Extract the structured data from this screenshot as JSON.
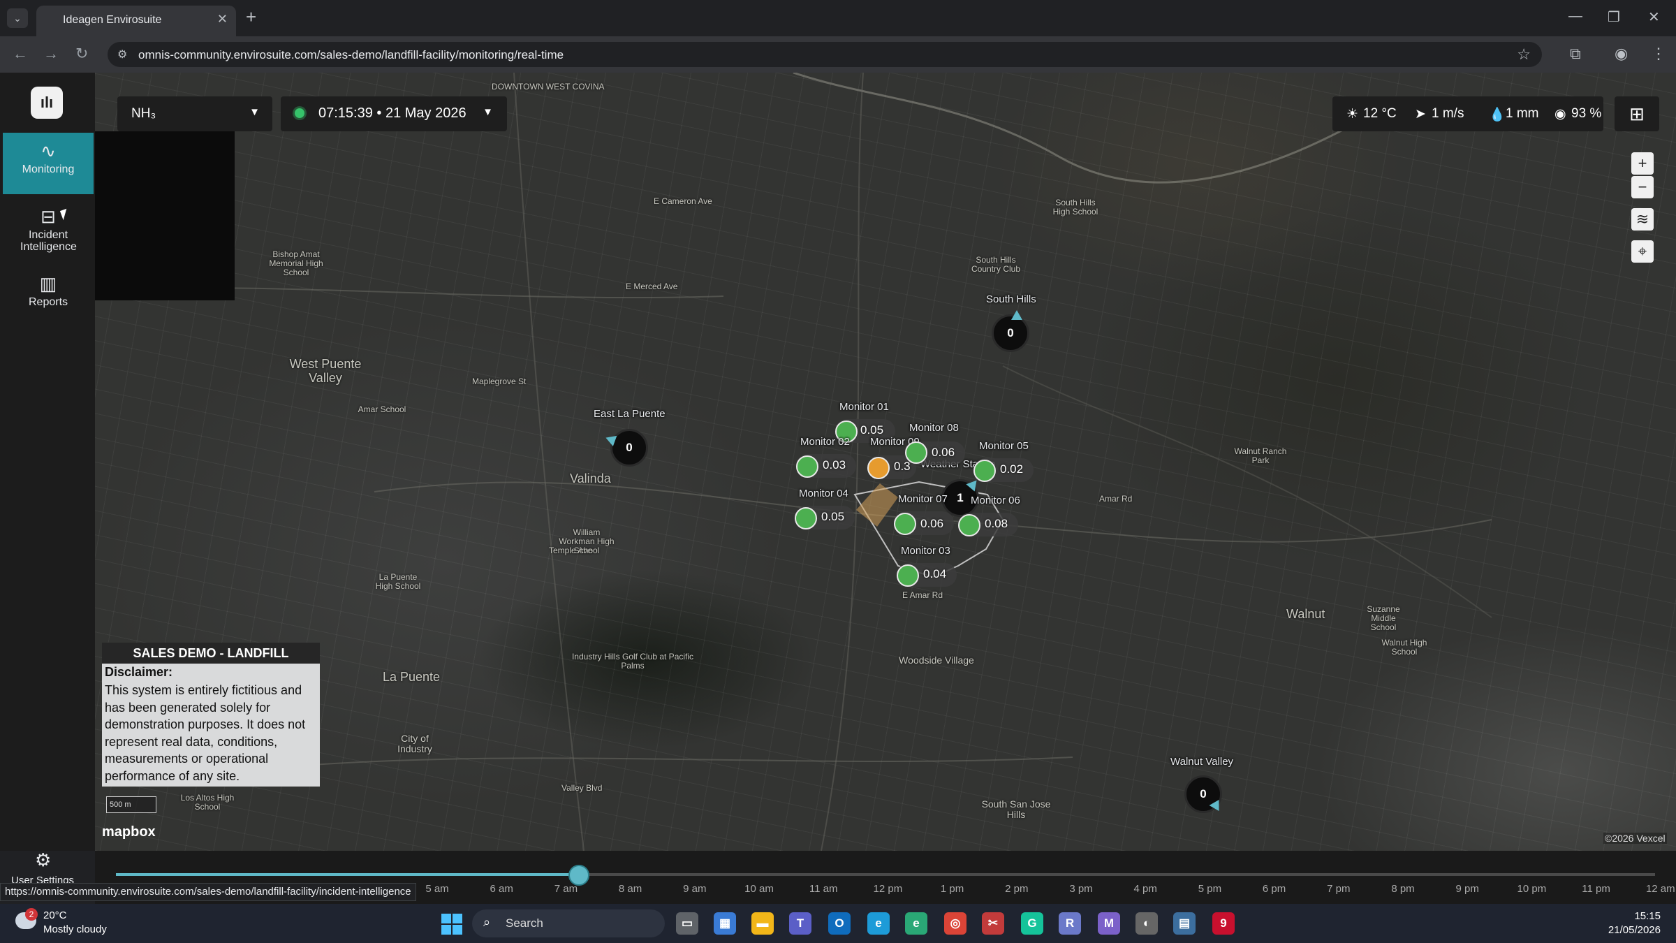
{
  "browser": {
    "tab_title": "Ideagen Envirosuite",
    "url": "omnis-community.envirosuite.com/sales-demo/landfill-facility/monitoring/real-time",
    "status_url": "https://omnis-community.envirosuite.com/sales-demo/landfill-facility/incident-intelligence"
  },
  "sidenav": {
    "items": [
      {
        "label": "Monitoring",
        "icon": "pulse-icon",
        "active": true
      },
      {
        "label": "Incident Intelligence",
        "icon": "incident-icon",
        "active": false
      },
      {
        "label": "Reports",
        "icon": "bar-chart-icon",
        "active": false
      }
    ],
    "settings_label": "User Settings"
  },
  "controls": {
    "pollutant": "NH₃",
    "time": "07:15:39 • 21 May 2026",
    "weather": {
      "temp": "12 °C",
      "wind": "1 m/s",
      "rain": "1 mm",
      "humidity": "93 %"
    }
  },
  "map": {
    "places": [
      "DOWNTOWN WEST COVINA",
      "West Puente Valley",
      "Valinda",
      "La Puente",
      "City of Industry",
      "Woodside Village",
      "Walnut",
      "Walnut Ranch Park",
      "South San Jose Hills",
      "Industry Hills Golf Club at Pacific Palms",
      "Bishop Amat Memorial High School",
      "South Hills Country Club",
      "Suzanne Middle School",
      "Amar Rd",
      "E Amar Rd",
      "Temple Ave",
      "Valley Blvd",
      "E Cameron Ave",
      "E Merced Ave",
      "Maplegrove St",
      "William Workman High School",
      "La Puente High School",
      "Los Altos High School",
      "South Hills High School",
      "Amar School",
      "Walnut High School"
    ],
    "sites": [
      {
        "name": "South Hills",
        "value": "0"
      },
      {
        "name": "East La Puente",
        "value": "0"
      },
      {
        "name": "Walnut Valley",
        "value": "0"
      },
      {
        "name": "Weather Station",
        "value": "1"
      }
    ],
    "monitors": [
      {
        "name": "Monitor 01",
        "value": "0.05",
        "status": "green"
      },
      {
        "name": "Monitor 02",
        "value": "0.03",
        "status": "green"
      },
      {
        "name": "Monitor 09",
        "value": "0.3",
        "status": "orange"
      },
      {
        "name": "Monitor 08",
        "value": "0.06",
        "status": "green"
      },
      {
        "name": "Monitor 05",
        "value": "0.02",
        "status": "green"
      },
      {
        "name": "Monitor 04",
        "value": "0.05",
        "status": "green"
      },
      {
        "name": "Monitor 07",
        "value": "0.06",
        "status": "green"
      },
      {
        "name": "Monitor 06",
        "value": "0.08",
        "status": "green"
      },
      {
        "name": "Monitor 03",
        "value": "0.04",
        "status": "green"
      }
    ],
    "scale": "500 m",
    "attribution": "mapbox",
    "copyright": "©2026 Vexcel"
  },
  "disclaimer": {
    "title": "SALES DEMO - LANDFILL",
    "heading": "Disclaimer:",
    "body": "This system is entirely fictitious and has been generated solely for demonstration purposes. It does not represent real data, conditions, measurements or operational performance of any site."
  },
  "timeline": {
    "ticks": [
      "5 am",
      "6 am",
      "7 am",
      "8 am",
      "9 am",
      "10 am",
      "11 am",
      "12 pm",
      "1 pm",
      "2 pm",
      "3 pm",
      "4 pm",
      "5 pm",
      "6 pm",
      "7 pm",
      "8 pm",
      "9 pm",
      "10 pm",
      "11 pm",
      "12 am"
    ],
    "progress": 0.3
  },
  "taskbar": {
    "temp": "20°C",
    "condition": "Mostly cloudy",
    "search": "Search",
    "time": "15:15",
    "date": "21/05/2026",
    "badge": "2"
  }
}
